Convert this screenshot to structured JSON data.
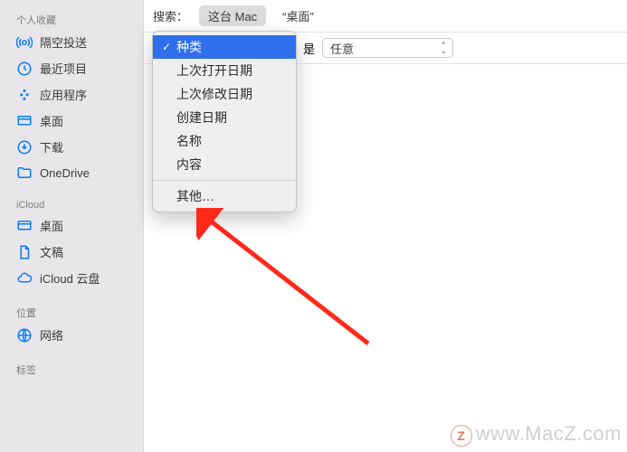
{
  "sidebar": {
    "sections": [
      {
        "header": "个人收藏",
        "items": [
          {
            "icon": "airdrop",
            "label": "隔空投送"
          },
          {
            "icon": "clock",
            "label": "最近项目"
          },
          {
            "icon": "apps",
            "label": "应用程序"
          },
          {
            "icon": "desktop",
            "label": "桌面"
          },
          {
            "icon": "download",
            "label": "下载"
          },
          {
            "icon": "folder",
            "label": "OneDrive"
          }
        ]
      },
      {
        "header": "iCloud",
        "items": [
          {
            "icon": "desktop",
            "label": "桌面"
          },
          {
            "icon": "document",
            "label": "文稿"
          },
          {
            "icon": "cloud",
            "label": "iCloud 云盘"
          }
        ]
      },
      {
        "header": "位置",
        "items": [
          {
            "icon": "network",
            "label": "网络"
          }
        ]
      },
      {
        "header": "标签",
        "items": []
      }
    ]
  },
  "search": {
    "label": "搜索：",
    "scopes": [
      "这台 Mac",
      "“桌面”"
    ],
    "selected_scope_index": 0
  },
  "criteria": {
    "attribute_label": "种类",
    "relation_label": "是",
    "value_label": "任意"
  },
  "popup": {
    "items": [
      {
        "label": "种类",
        "selected": true
      },
      {
        "label": "上次打开日期",
        "selected": false
      },
      {
        "label": "上次修改日期",
        "selected": false
      },
      {
        "label": "创建日期",
        "selected": false
      },
      {
        "label": "名称",
        "selected": false
      },
      {
        "label": "内容",
        "selected": false
      }
    ],
    "other_label": "其他…"
  },
  "watermark": {
    "z": "Z",
    "text": "www.MacZ.com"
  }
}
